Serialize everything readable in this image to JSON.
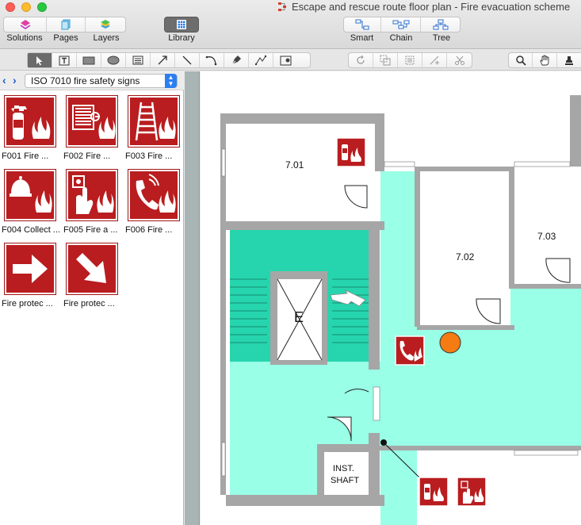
{
  "window": {
    "title": "Escape and rescue route floor plan - Fire evacuation scheme"
  },
  "toolbar": {
    "solutions_label": "Solutions",
    "pages_label": "Pages",
    "layers_label": "Layers",
    "library_label": "Library",
    "smart_label": "Smart",
    "chain_label": "Chain",
    "tree_label": "Tree"
  },
  "drawing_tools": [
    "select-pointer",
    "text-tool",
    "rectangle-tool",
    "ellipse-tool",
    "container-tool",
    "line-arrow-tool",
    "line-tool",
    "arc-tool",
    "pen-tool",
    "freehand-tool",
    "insert-image-tool"
  ],
  "library": {
    "selected": "ISO 7010 fire safety signs",
    "items": [
      {
        "caption": "F001 Fire  ...",
        "icon": "fire-extinguisher-sign-icon"
      },
      {
        "caption": "F002 Fire  ...",
        "icon": "fire-hose-reel-sign-icon"
      },
      {
        "caption": "F003 Fire  ...",
        "icon": "fire-ladder-sign-icon"
      },
      {
        "caption": "F004 Collect ...",
        "icon": "fire-equipment-collection-sign-icon"
      },
      {
        "caption": "F005 Fire a ...",
        "icon": "fire-alarm-call-point-sign-icon"
      },
      {
        "caption": "F006 Fire  ...",
        "icon": "fire-emergency-telephone-sign-icon"
      },
      {
        "caption": "Fire protec ...",
        "icon": "direction-arrow-right-sign-icon"
      },
      {
        "caption": "Fire protec ...",
        "icon": "direction-arrow-diagonal-sign-icon"
      }
    ]
  },
  "floorplan": {
    "rooms": [
      "7.01",
      "7.02",
      "7.03"
    ],
    "shaft_label_1": "INST.",
    "shaft_label_2": "SHAFT",
    "stair_letter": "E",
    "colors": {
      "escape_route": "#99ffe6",
      "stairwell": "#26d5ad",
      "wall": "#a6a6a6",
      "sign_red": "#b91d1f",
      "marker_orange": "#f57c12"
    }
  }
}
